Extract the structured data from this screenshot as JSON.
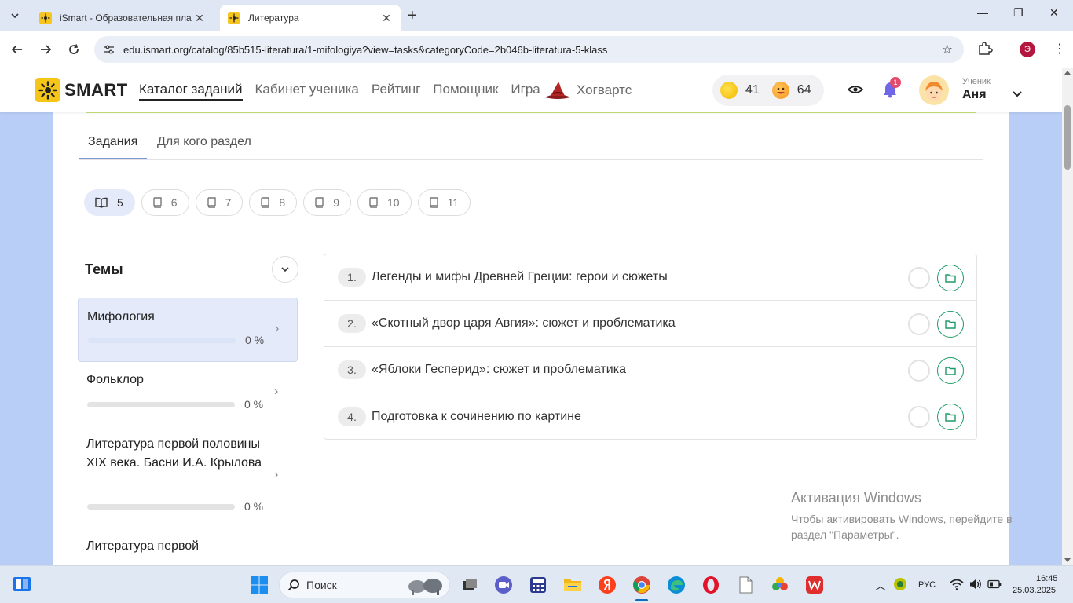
{
  "browser": {
    "tabs": [
      {
        "title": "iSmart - Образовательная пла",
        "active": false
      },
      {
        "title": "Литература",
        "active": true
      }
    ],
    "url": "edu.ismart.org/catalog/85b515-literatura/1-mifologiya?view=tasks&categoryCode=2b046b-literatura-5-klass",
    "profile_initial": "Э"
  },
  "header": {
    "logo_text": "SMART",
    "nav": [
      "Каталог заданий",
      "Кабинет ученика",
      "Рейтинг",
      "Помощник",
      "Игра"
    ],
    "hogwarts_label": "Хогвартс",
    "coins": "41",
    "smiles": "64",
    "notifications_count": "1",
    "user_role": "Ученик",
    "user_name": "Аня"
  },
  "subtabs": [
    "Задания",
    "Для кого раздел"
  ],
  "grades": [
    "5",
    "6",
    "7",
    "8",
    "9",
    "10",
    "11"
  ],
  "themes_title": "Темы",
  "themes": [
    {
      "name": "Мифология",
      "percent": "0 %",
      "progress": 0
    },
    {
      "name": "Фольклор",
      "percent": "0 %",
      "progress": 0
    },
    {
      "name": "Литература первой половины XIX века. Басни И.А. Крылова",
      "percent": "0 %",
      "progress": 0
    },
    {
      "name": "Литература первой",
      "percent": "",
      "progress": 0
    }
  ],
  "tasks": [
    {
      "num": "1.",
      "title": "Легенды и мифы Древней Греции: герои и сюжеты"
    },
    {
      "num": "2.",
      "title": "«Скотный двор царя Авгия»: сюжет и проблематика"
    },
    {
      "num": "3.",
      "title": "«Яблоки Гесперид»: сюжет и проблематика"
    },
    {
      "num": "4.",
      "title": "Подготовка к сочинению по картине"
    }
  ],
  "watermark": {
    "title": "Активация Windows",
    "text": "Чтобы активировать Windows, перейдите в раздел \"Параметры\"."
  },
  "taskbar": {
    "search_label": "Поиск",
    "lang": "РУС",
    "time": "16:45",
    "date": "25.03.2025"
  },
  "colors": {
    "accent_yellow": "#f5c518",
    "page_bg": "#b9cef6",
    "active_pill": "#e4eaf9",
    "folder_green": "#1f9a66"
  }
}
